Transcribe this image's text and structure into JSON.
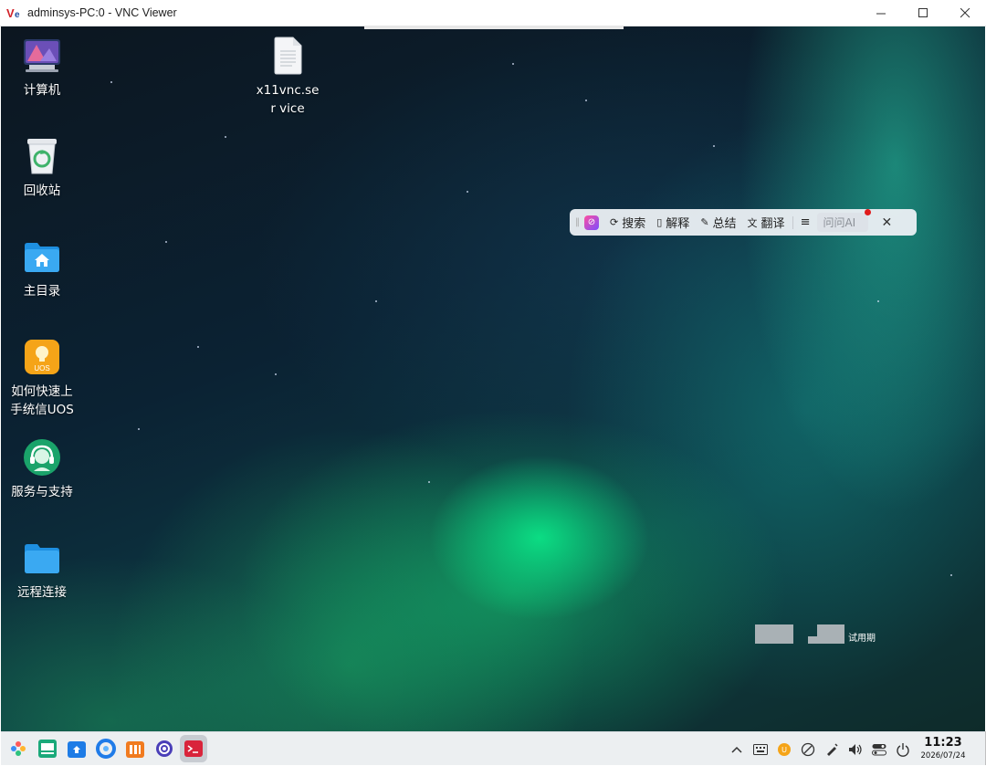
{
  "window": {
    "title": "adminsys-PC:0 - VNC Viewer",
    "controls": [
      "minimize-icon",
      "maximize-icon",
      "close-icon"
    ]
  },
  "desktop_icons": [
    {
      "name": "computer",
      "label": "计算机",
      "icon": "computer-icon"
    },
    {
      "name": "trash",
      "label": "回收站",
      "icon": "trash-icon"
    },
    {
      "name": "home",
      "label": "主目录",
      "icon": "home-folder-icon"
    },
    {
      "name": "uos-guide",
      "label": "如何快速上手统信UOS",
      "icon": "uos-bulb-icon",
      "icon_text": "UOS"
    },
    {
      "name": "service",
      "label": "服务与支持",
      "icon": "support-headset-icon"
    },
    {
      "name": "remote",
      "label": "远程连接",
      "icon": "folder-icon"
    },
    {
      "name": "x11vnc-file",
      "label": "x11vnc.ser vice",
      "icon": "text-file-icon"
    }
  ],
  "ai_bar": {
    "search": "搜索",
    "explain": "解释",
    "summary": "总结",
    "translate": "翻译",
    "ask_ai": "问问AI"
  },
  "trial_text": "试用期",
  "taskbar": {
    "apps": [
      "launcher-icon",
      "multitask-view-icon",
      "app-store-icon",
      "browser-icon",
      "file-manager-icon",
      "settings-icon",
      "terminal-icon"
    ],
    "tray": [
      "chevron-up-icon",
      "keyboard-icon",
      "uos-ai-icon",
      "assistant-icon",
      "pen-icon",
      "volume-icon",
      "control-center-icon",
      "power-icon"
    ],
    "time": "11:23",
    "date": "2026/07/24"
  },
  "colors": {
    "accent_green": "#0ae88c",
    "taskbar_bg": "#ebeef1",
    "red_dot": "#e01b1b"
  }
}
